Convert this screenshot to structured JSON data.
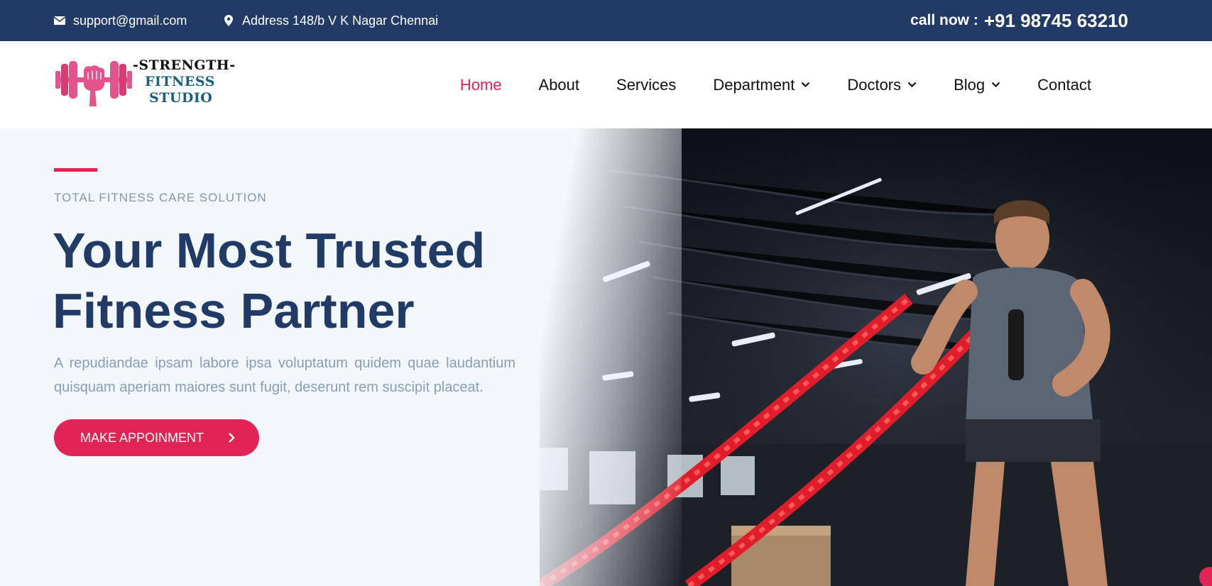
{
  "topbar": {
    "email": "support@gmail.com",
    "email_icon": "envelope-icon",
    "address": "Address 148/b V K Nagar Chennai",
    "address_icon": "map-pin-icon",
    "call_label": "call now :",
    "call_number": "+91 98745 63210"
  },
  "logo": {
    "line1": "-STRENGTH-",
    "line2": "FITNESS",
    "line3": "STUDIO",
    "icon": "dumbbell-fist-icon"
  },
  "nav": {
    "items": [
      {
        "label": "Home",
        "active": true
      },
      {
        "label": "About"
      },
      {
        "label": "Services"
      },
      {
        "label": "Department",
        "dropdown": true
      },
      {
        "label": "Doctors",
        "dropdown": true
      },
      {
        "label": "Blog",
        "dropdown": true
      },
      {
        "label": "Contact"
      }
    ]
  },
  "hero": {
    "subtitle": "TOTAL FITNESS CARE SOLUTION",
    "headline_line1": "Your Most Trusted",
    "headline_line2": "Fitness Partner",
    "lead": "A repudiandae ipsam labore ipsa voluptatum quidem quae laudantium quisquam aperiam maiores sunt fugit, deserunt rem suscipit placeat.",
    "cta_label": "MAKE APPOINMENT",
    "cta_icon": "chevron-right-icon",
    "photo": "man-with-battle-ropes-in-gym"
  },
  "colors": {
    "navy": "#223a66",
    "accent": "#e12454",
    "hero_bg": "#f2f7fc",
    "muted_text": "#8b9db1"
  }
}
